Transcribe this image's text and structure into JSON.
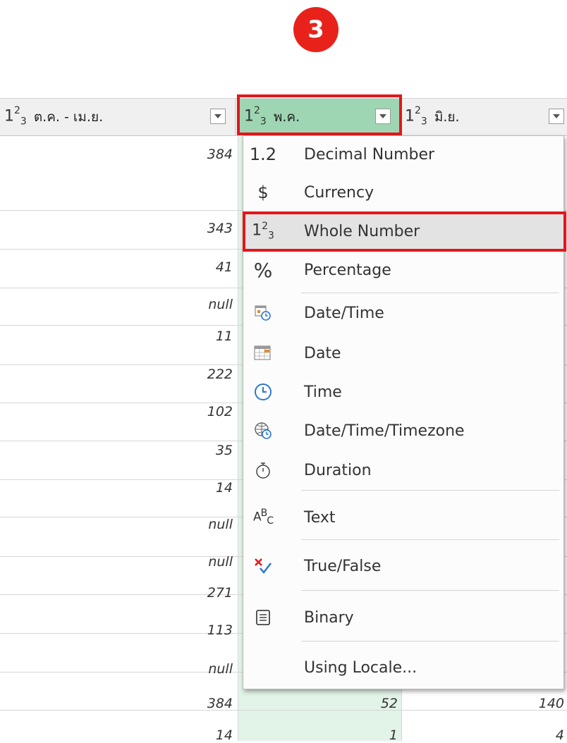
{
  "step_badge": "3",
  "columns": [
    {
      "type_base": "1",
      "type_sup": "2",
      "type_sub": "3",
      "title": "ต.ค. - เม.ย."
    },
    {
      "type_base": "1",
      "type_sup": "2",
      "type_sub": "3",
      "title": "พ.ค."
    },
    {
      "type_base": "1",
      "type_sup": "2",
      "type_sub": "3",
      "title": "มิ.ย."
    }
  ],
  "rows": [
    {
      "c1": "384",
      "c2": "",
      "c3": ""
    },
    {
      "c1": "343",
      "c2": "",
      "c3": ""
    },
    {
      "c1": "41",
      "c2": "",
      "c3": ""
    },
    {
      "c1": "null",
      "c2": "",
      "c3": ""
    },
    {
      "c1": "11",
      "c2": "",
      "c3": ""
    },
    {
      "c1": "222",
      "c2": "",
      "c3": ""
    },
    {
      "c1": "102",
      "c2": "",
      "c3": ""
    },
    {
      "c1": "35",
      "c2": "",
      "c3": ""
    },
    {
      "c1": "14",
      "c2": "",
      "c3": ""
    },
    {
      "c1": "null",
      "c2": "",
      "c3": ""
    },
    {
      "c1": "null",
      "c2": "",
      "c3": ""
    },
    {
      "c1": "271",
      "c2": "",
      "c3": ""
    },
    {
      "c1": "113",
      "c2": "",
      "c3": ""
    },
    {
      "c1": "null",
      "c2": "",
      "c3": ""
    },
    {
      "c1": "384",
      "c2": "52",
      "c3": "140"
    },
    {
      "c1": "14",
      "c2": "1",
      "c3": "4"
    }
  ],
  "menu": {
    "items": [
      {
        "icon": "decimal-number-icon",
        "glyph": "1.2",
        "label": "Decimal Number"
      },
      {
        "icon": "currency-icon",
        "glyph": "$",
        "label": "Currency"
      },
      {
        "icon": "whole-number-icon",
        "glyph": "123",
        "label": "Whole Number",
        "selected": true
      },
      {
        "icon": "percentage-icon",
        "glyph": "%",
        "label": "Percentage"
      },
      {
        "icon": "date-time-icon",
        "glyph": "",
        "label": "Date/Time"
      },
      {
        "icon": "date-icon",
        "glyph": "",
        "label": "Date"
      },
      {
        "icon": "time-icon",
        "glyph": "",
        "label": "Time"
      },
      {
        "icon": "date-time-timezone-icon",
        "glyph": "",
        "label": "Date/Time/Timezone"
      },
      {
        "icon": "duration-icon",
        "glyph": "",
        "label": "Duration"
      },
      {
        "icon": "text-icon",
        "glyph": "ABC",
        "label": "Text"
      },
      {
        "icon": "true-false-icon",
        "glyph": "",
        "label": "True/False"
      },
      {
        "icon": "binary-icon",
        "glyph": "",
        "label": "Binary"
      },
      {
        "icon": "",
        "glyph": "",
        "label": "Using Locale..."
      }
    ]
  },
  "colors": {
    "highlight_red": "#e3161b",
    "badge_red": "#e8221b",
    "selected_column_header": "#9ed6b4",
    "selected_column_cells": "#e2f3e8"
  }
}
